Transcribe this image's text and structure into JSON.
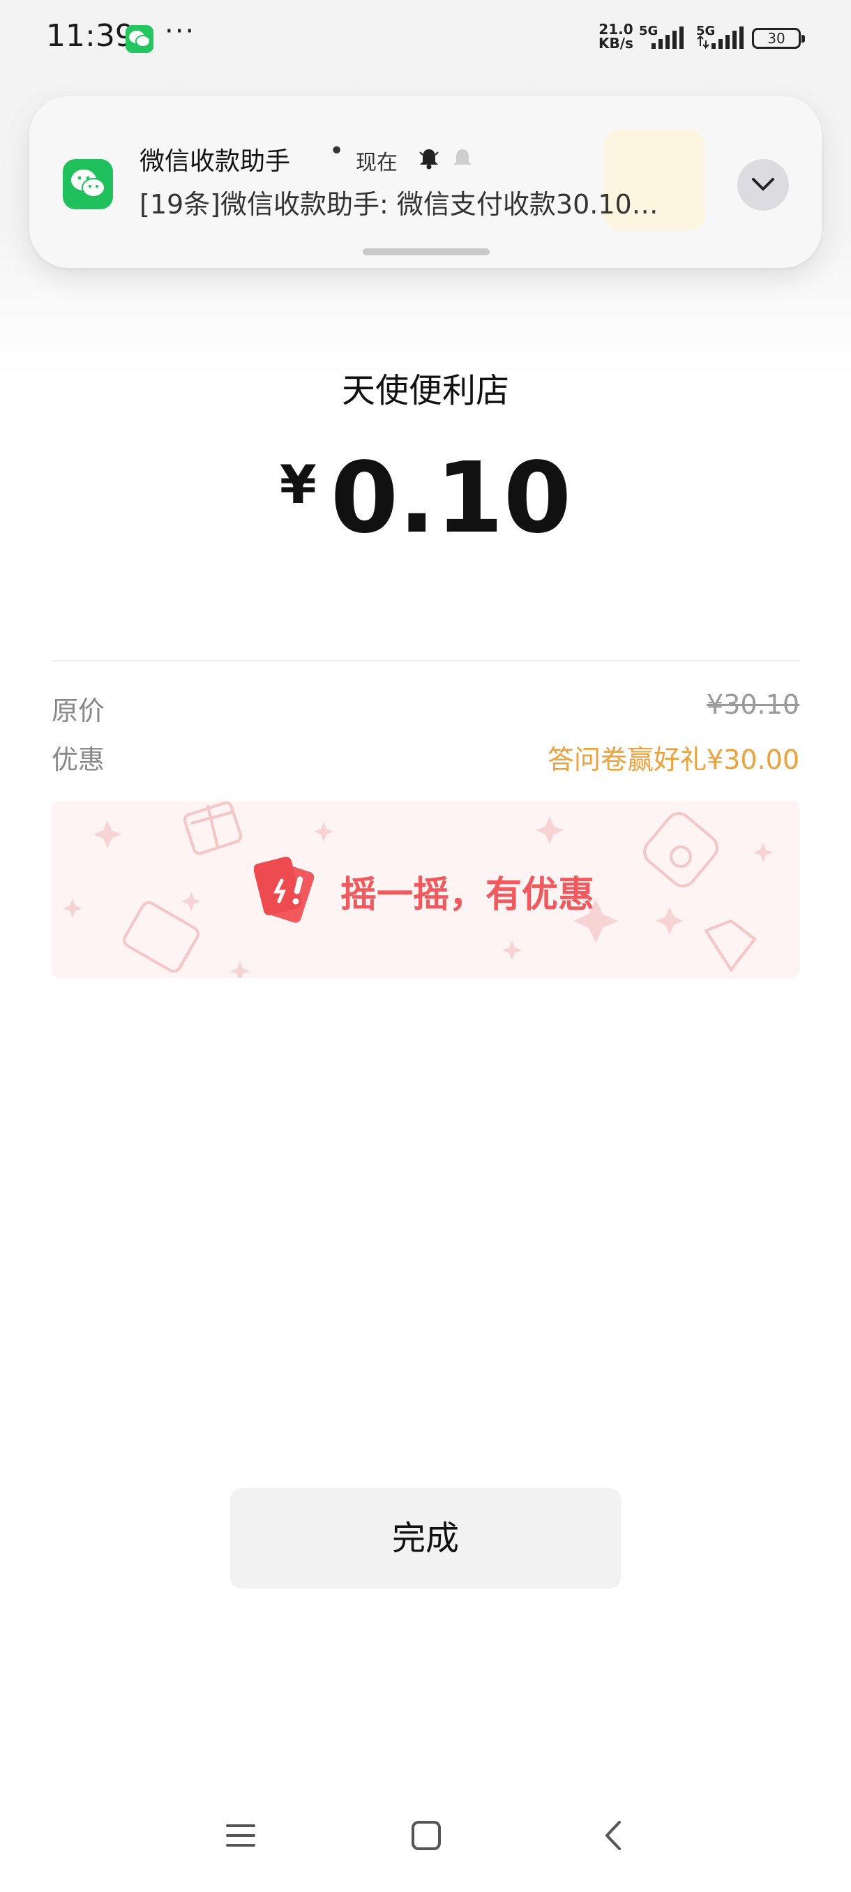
{
  "status_bar": {
    "time": "11:39",
    "more": "···",
    "net_speed_value": "21.0",
    "net_speed_unit": "KB/s",
    "signal1_tag": "5G",
    "signal2_tag": "5G",
    "battery": "30"
  },
  "notification": {
    "app_name": "微信收款助手",
    "separator": "•",
    "time": "现在",
    "body": "[19条]微信收款助手: 微信支付收款30.10…"
  },
  "receipt": {
    "store_name": "天使便利店",
    "currency": "¥",
    "amount": "0.10",
    "original_label": "原价",
    "original_value": "¥30.10",
    "discount_label": "优惠",
    "discount_value": "答问卷赢好礼¥30.00"
  },
  "promo": {
    "text": "摇一摇，有优惠"
  },
  "done_label": "完成",
  "colors": {
    "wechat_green": "#20c05c",
    "discount_orange": "#eea23d",
    "promo_red": "#f05a5e",
    "promo_bg": "#fff4f4"
  },
  "nav": {
    "icons": [
      "menu-icon",
      "home-square-icon",
      "back-chevron-icon"
    ]
  }
}
